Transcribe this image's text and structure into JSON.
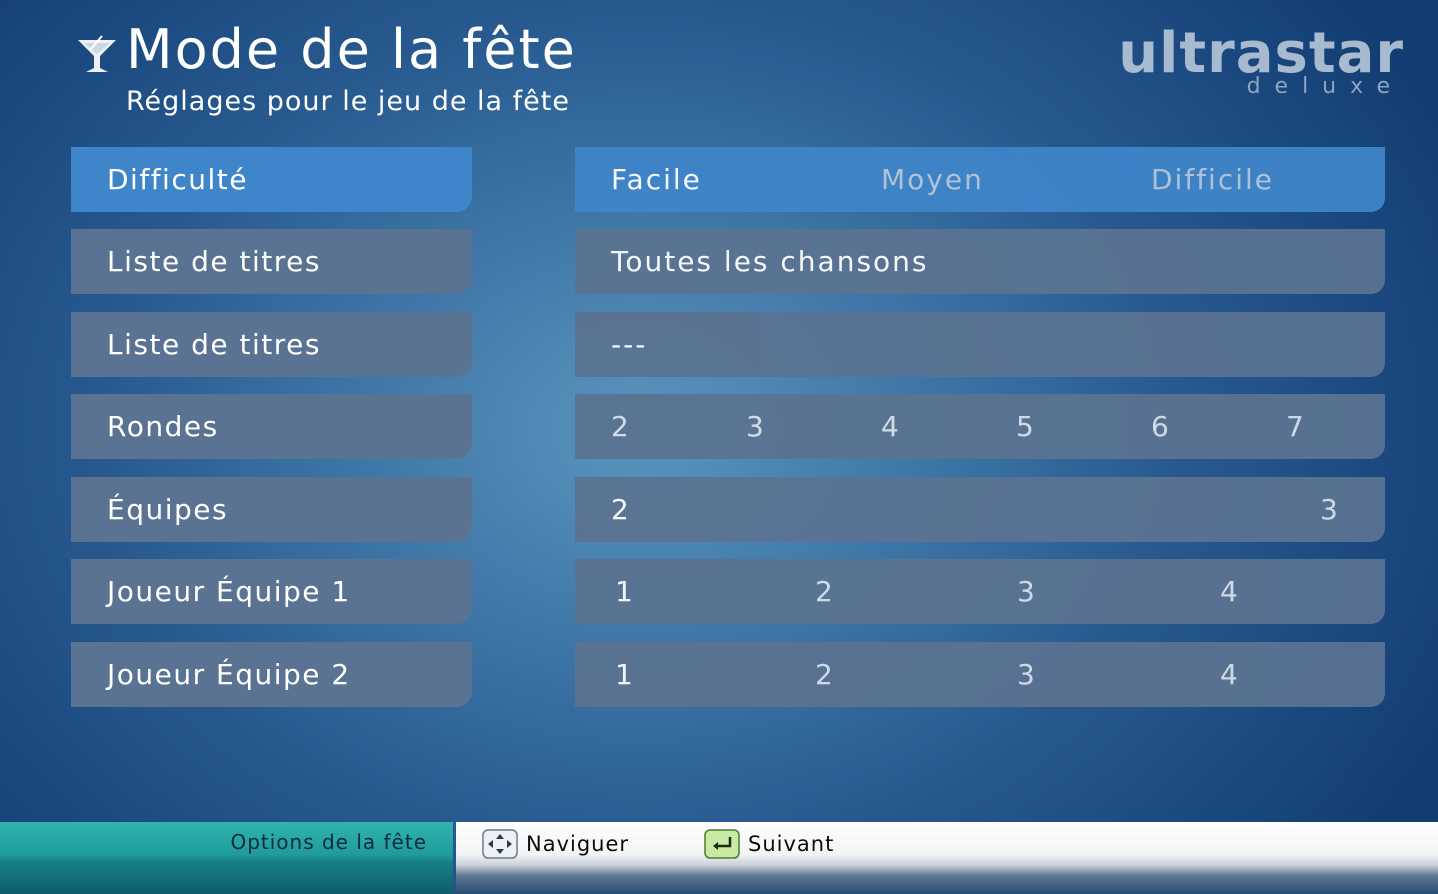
{
  "header": {
    "title": "Mode de la fête",
    "subtitle": "Réglages pour le jeu de la fête",
    "logo_main": "ultrastar",
    "logo_sub": "deluxe",
    "title_icon": "cocktail-glass-icon"
  },
  "settings": [
    {
      "label": "Difficulté",
      "options": [
        "Facile",
        "Moyen",
        "Difficile"
      ],
      "selected": "Facile"
    },
    {
      "label": "Liste de titres",
      "options": [
        "Toutes les chansons"
      ],
      "selected": "Toutes les chansons"
    },
    {
      "label": "Liste de titres",
      "options": [
        "---"
      ],
      "selected": "---"
    },
    {
      "label": "Rondes",
      "options": [
        "2",
        "3",
        "4",
        "5",
        "6",
        "7"
      ]
    },
    {
      "label": "Équipes",
      "options": [
        "2",
        "3"
      ]
    },
    {
      "label": "Joueur Équipe 1",
      "options": [
        "1",
        "2",
        "3",
        "4"
      ]
    },
    {
      "label": "Joueur Équipe 2",
      "options": [
        "1",
        "2",
        "3",
        "4"
      ]
    }
  ],
  "footer": {
    "section_label": "Options de la fête",
    "navigate_label": "Naviguer",
    "navigate_icon": "arrow-keys-icon",
    "next_label": "Suivant",
    "next_icon": "enter-key-icon"
  },
  "colors": {
    "active_row": "#3f85c9",
    "row": "#5b7392",
    "footer_teal": "#1f9c9c"
  }
}
